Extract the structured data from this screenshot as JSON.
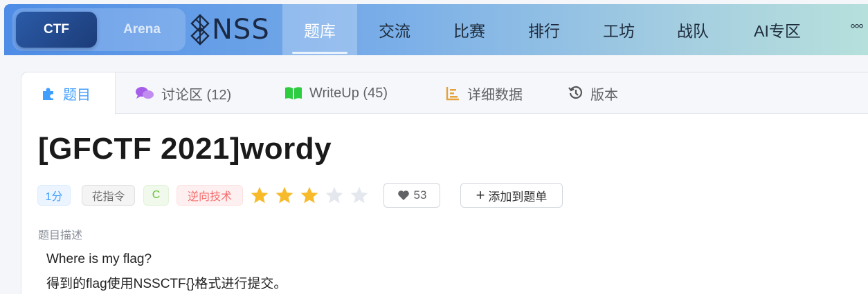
{
  "topnav": {
    "mode_ctf": "CTF",
    "mode_arena": "Arena",
    "logo_text": "NSS",
    "items": [
      "题库",
      "交流",
      "比赛",
      "排行",
      "工坊",
      "战队",
      "AI专区"
    ],
    "more": "°°°",
    "gradient": [
      "#4e8ce6",
      "#b6e0dc"
    ]
  },
  "tabs": [
    {
      "label": "题目",
      "icon": "puzzle-icon",
      "active": true
    },
    {
      "label": "讨论区 (12)",
      "icon": "chat-bubbles-icon"
    },
    {
      "label": "WriteUp (45)",
      "icon": "book-icon"
    },
    {
      "label": "详细数据",
      "icon": "chart-bars-icon"
    },
    {
      "label": "版本",
      "icon": "history-icon"
    }
  ],
  "problem": {
    "title": "[GFCTF 2021]wordy",
    "tags": {
      "score": "1分",
      "author": "花指令",
      "lang": "C",
      "category": "逆向技术"
    },
    "difficulty_stars": 3,
    "difficulty_max": 5,
    "likes": "53",
    "add_button": "添加到题单",
    "desc_label": "题目描述",
    "desc_lines": [
      "Where is my flag?",
      "得到的flag使用NSSCTF{}格式进行提交。"
    ]
  },
  "colors": {
    "accent": "#409eff",
    "star_on": "#f7ba2a",
    "star_off": "#e4e7ed"
  }
}
